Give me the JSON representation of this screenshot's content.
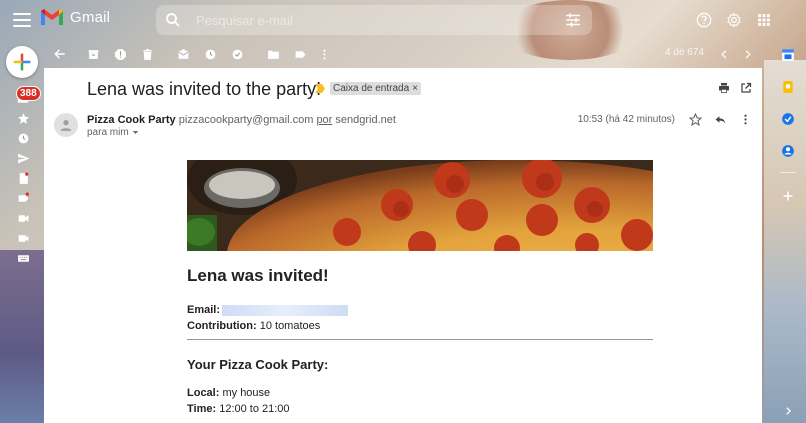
{
  "app": {
    "name": "Gmail"
  },
  "search": {
    "placeholder": "Pesquisar e-mail"
  },
  "left_rail": {
    "inbox_badge": "388"
  },
  "toolbar": {
    "pager": "4 de 674"
  },
  "email": {
    "subject": "Lena was invited to the party!",
    "label": "Caixa de entrada",
    "label_close": "×",
    "sender_name": "Pizza Cook Party",
    "sender_email": "pizzacookparty@gmail.com",
    "via_word": "por",
    "via_domain": "sendgrid.net",
    "recipient": "para mim",
    "time": "10:53 (há 42 minutos)"
  },
  "body": {
    "heading": "Lena was invited!",
    "email_label": "Email:",
    "contribution_label": "Contribution:",
    "contribution_value": "10 tomatoes",
    "party_heading": "Your Pizza Cook Party:",
    "local_label": "Local:",
    "local_value": "my house",
    "time_label": "Time:",
    "time_value": "12:00 to 21:00"
  },
  "colors": {
    "badge": "#d93025",
    "importance": "#f6bf26",
    "card_bg": "#ffffff"
  }
}
